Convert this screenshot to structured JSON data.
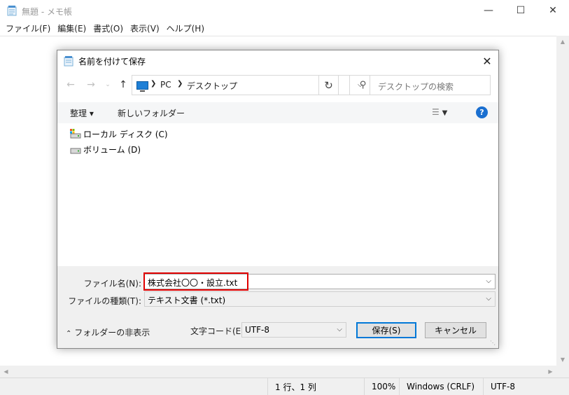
{
  "notepad": {
    "title": "無題 - メモ帳",
    "menu": [
      "ファイル(F)",
      "編集(E)",
      "書式(O)",
      "表示(V)",
      "ヘルプ(H)"
    ],
    "status": {
      "position": "1 行、1 列",
      "zoom": "100%",
      "line_ending": "Windows (CRLF)",
      "encoding": "UTF-8"
    }
  },
  "dialog": {
    "title": "名前を付けて保存",
    "breadcrumb": [
      "PC",
      "デスクトップ"
    ],
    "search_placeholder": "デスクトップの検索",
    "toolbar": {
      "organize": "整理 ▾",
      "new_folder": "新しいフォルダー"
    },
    "drives": [
      "ローカル ディスク (C)",
      "ボリューム (D)"
    ],
    "filename_label": "ファイル名(N):",
    "filename_value": "株式会社〇〇・設立.txt",
    "filetype_label": "ファイルの種類(T):",
    "filetype_value": "テキスト文書 (*.txt)",
    "hide_folders": "フォルダーの非表示",
    "encoding_label": "文字コード(E):",
    "encoding_value": "UTF-8",
    "save_button": "保存(S)",
    "cancel_button": "キャンセル"
  },
  "colors": {
    "highlight": "#e00000",
    "accent": "#0078d7",
    "help": "#1a6fd0"
  }
}
